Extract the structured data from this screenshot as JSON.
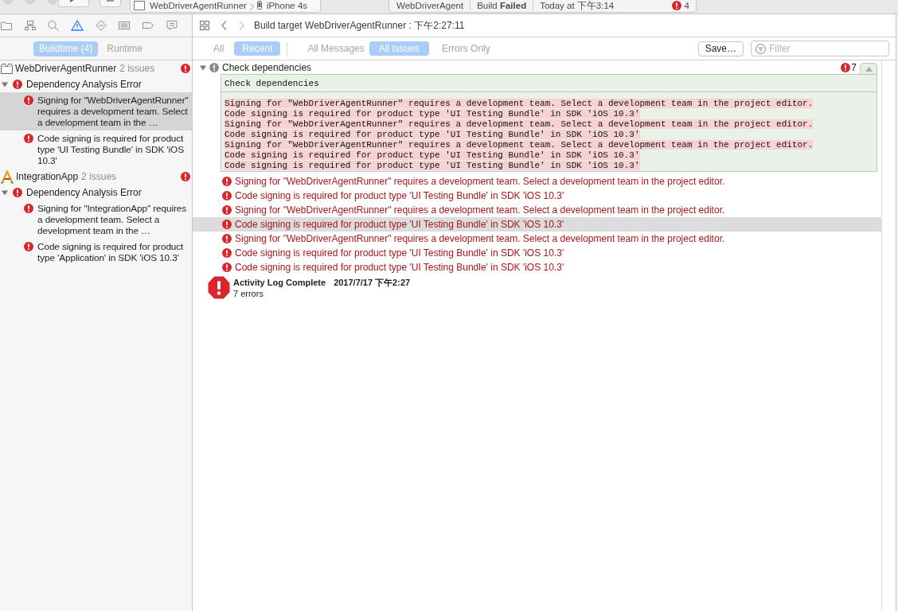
{
  "toolbar": {
    "scheme": "WebDriverAgentRunner",
    "device": "iPhone 4s",
    "activity": {
      "project": "WebDriverAgent",
      "status": "Build **Failed**",
      "time": "Today at 下午3:14",
      "error_count": "4"
    }
  },
  "navigator_tabs": [
    {
      "kind": "project",
      "selected": false
    },
    {
      "kind": "symbols",
      "selected": false
    },
    {
      "kind": "find",
      "selected": false
    },
    {
      "kind": "issues",
      "selected": true
    },
    {
      "kind": "tests",
      "selected": false
    },
    {
      "kind": "debug",
      "selected": false
    },
    {
      "kind": "breakpoints",
      "selected": false
    },
    {
      "kind": "reports",
      "selected": false
    }
  ],
  "scope_tabs": [
    {
      "label": "Buildtime (4)",
      "selected": true
    },
    {
      "label": "Runtime",
      "selected": false
    }
  ],
  "issue_tree": [
    {
      "kind": "bundle",
      "name": "WebDriverAgentRunner",
      "count": "2 issues",
      "children": [
        {
          "title": "Dependency Analysis Error",
          "expanded": true,
          "children": [
            {
              "text": "Signing for \"WebDriverAgentRunner\" requires a development team. Select a development team in the …",
              "selected": true
            },
            {
              "text": "Code signing is required for product type 'UI Testing Bundle' in SDK 'iOS 10.3'",
              "selected": false
            }
          ]
        }
      ]
    },
    {
      "kind": "app",
      "name": "IntegrationApp",
      "count": "2 issues",
      "children": [
        {
          "title": "Dependency Analysis Error",
          "expanded": true,
          "children": [
            {
              "text": "Signing for \"IntegrationApp\" requires a development team. Select a development team in the …",
              "selected": false
            },
            {
              "text": "Code signing is required for product type 'Application' in SDK 'iOS 10.3'",
              "selected": false
            }
          ]
        }
      ]
    }
  ],
  "jump_bar": {
    "breadcrumb": "Build target WebDriverAgentRunner : 下午2:27:11"
  },
  "filter_bar": {
    "scope_filters": [
      {
        "label": "All",
        "selected": false
      },
      {
        "label": "Recent",
        "selected": true
      }
    ],
    "message_filters": [
      {
        "label": "All Messages",
        "selected": false
      },
      {
        "label": "All Issues",
        "selected": true
      },
      {
        "label": "Errors Only",
        "selected": false
      }
    ],
    "save_button": "Save…",
    "filter_field": {
      "placeholder": "Filter"
    }
  },
  "log": {
    "section": {
      "title": "Check dependencies",
      "expanded": true,
      "error_count": "7",
      "transcript": {
        "command": "Check dependencies",
        "lines": [
          "Signing for \"WebDriverAgentRunner\" requires a development team. Select a development team in the project editor.",
          "Code signing is required for product type 'UI Testing Bundle' in SDK 'iOS 10.3'",
          "Signing for \"WebDriverAgentRunner\" requires a development team. Select a development team in the project editor.",
          "Code signing is required for product type 'UI Testing Bundle' in SDK 'iOS 10.3'",
          "Signing for \"WebDriverAgentRunner\" requires a development team. Select a development team in the project editor.",
          "Code signing is required for product type 'UI Testing Bundle' in SDK 'iOS 10.3'",
          "Code signing is required for product type 'UI Testing Bundle' in SDK 'iOS 10.3'"
        ]
      }
    },
    "issues": [
      {
        "text": "Signing for \"WebDriverAgentRunner\" requires a development team. Select a development team in the project editor.",
        "selected": false
      },
      {
        "text": "Code signing is required for product type 'UI Testing Bundle' in SDK 'iOS 10.3'",
        "selected": false
      },
      {
        "text": "Signing for \"WebDriverAgentRunner\" requires a development team. Select a development team in the project editor.",
        "selected": false
      },
      {
        "text": "Code signing is required for product type 'UI Testing Bundle' in SDK 'iOS 10.3'",
        "selected": true
      },
      {
        "text": "Signing for \"WebDriverAgentRunner\" requires a development team. Select a development team in the project editor.",
        "selected": false
      },
      {
        "text": "Code signing is required for product type 'UI Testing Bundle' in SDK 'iOS 10.3'",
        "selected": false
      },
      {
        "text": "Code signing is required for product type 'UI Testing Bundle' in SDK 'iOS 10.3'",
        "selected": false
      }
    ],
    "summary": {
      "title": "Activity Log Complete",
      "time": "2017/7/17 下午2:27",
      "detail": "7 errors"
    }
  }
}
